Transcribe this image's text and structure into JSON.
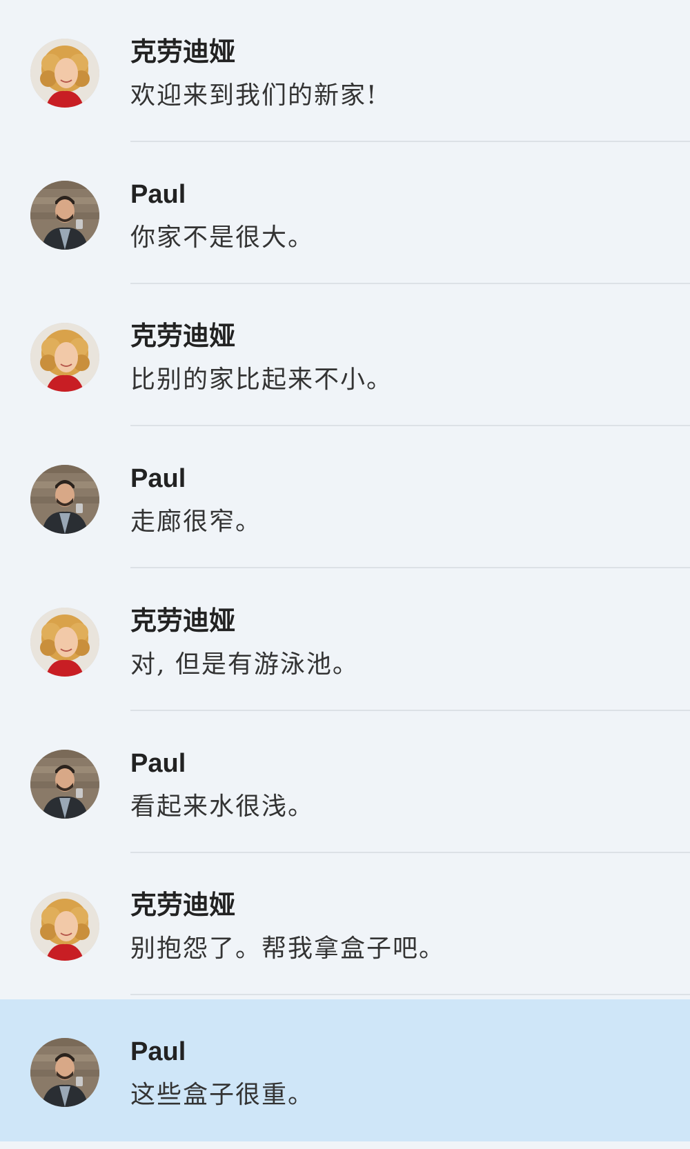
{
  "messages": [
    {
      "sender": "克劳迪娅",
      "avatar": "woman-curly-hair-avatar",
      "text": "欢迎来到我们的新家!"
    },
    {
      "sender": "Paul",
      "avatar": "man-beard-avatar",
      "text": "你家不是很大。"
    },
    {
      "sender": "克劳迪娅",
      "avatar": "woman-curly-hair-avatar",
      "text": "比别的家比起来不小。"
    },
    {
      "sender": "Paul",
      "avatar": "man-beard-avatar",
      "text": "走廊很窄。"
    },
    {
      "sender": "克劳迪娅",
      "avatar": "woman-curly-hair-avatar",
      "text": "对, 但是有游泳池。"
    },
    {
      "sender": "Paul",
      "avatar": "man-beard-avatar",
      "text": "看起来水很浅。"
    },
    {
      "sender": "克劳迪娅",
      "avatar": "woman-curly-hair-avatar",
      "text": "别抱怨了。帮我拿盒子吧。"
    },
    {
      "sender": "Paul",
      "avatar": "man-beard-avatar",
      "text": "这些盒子很重。",
      "highlighted": true
    }
  ],
  "colors": {
    "background": "#f0f4f8",
    "highlight": "#cfe6f8",
    "divider": "#dce1e6"
  }
}
